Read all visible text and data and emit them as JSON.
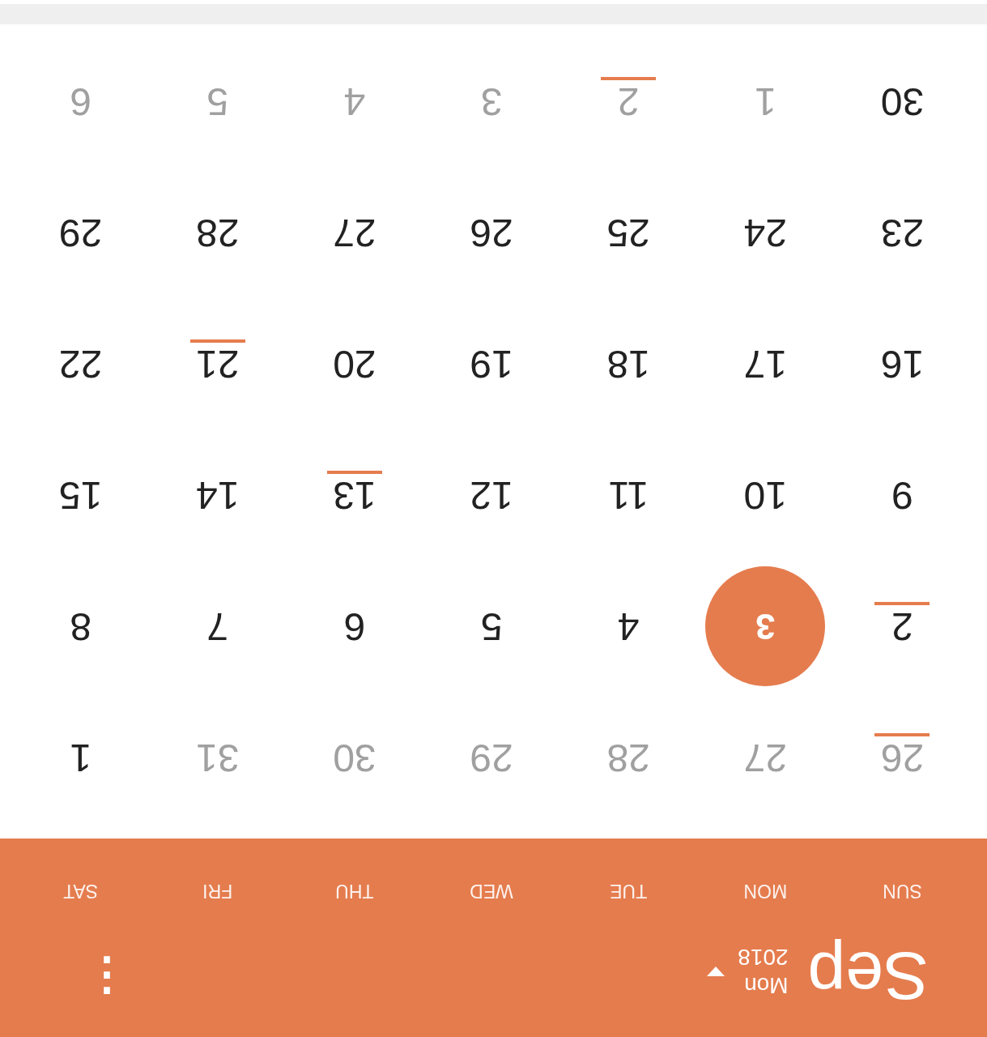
{
  "header": {
    "month": "Sep",
    "weekday": "Mon",
    "year": "2018",
    "menu": "⋮"
  },
  "weekdays": [
    "SUN",
    "MON",
    "TUE",
    "WED",
    "THU",
    "FRI",
    "SAT"
  ],
  "weeks": [
    [
      {
        "day": "26",
        "muted": true,
        "event": true,
        "selected": false
      },
      {
        "day": "27",
        "muted": true,
        "event": false,
        "selected": false
      },
      {
        "day": "28",
        "muted": true,
        "event": false,
        "selected": false
      },
      {
        "day": "29",
        "muted": true,
        "event": false,
        "selected": false
      },
      {
        "day": "30",
        "muted": true,
        "event": false,
        "selected": false
      },
      {
        "day": "31",
        "muted": true,
        "event": false,
        "selected": false
      },
      {
        "day": "1",
        "muted": false,
        "event": false,
        "selected": false
      }
    ],
    [
      {
        "day": "2",
        "muted": false,
        "event": true,
        "selected": false
      },
      {
        "day": "3",
        "muted": false,
        "event": false,
        "selected": true
      },
      {
        "day": "4",
        "muted": false,
        "event": false,
        "selected": false
      },
      {
        "day": "5",
        "muted": false,
        "event": false,
        "selected": false
      },
      {
        "day": "6",
        "muted": false,
        "event": false,
        "selected": false
      },
      {
        "day": "7",
        "muted": false,
        "event": false,
        "selected": false
      },
      {
        "day": "8",
        "muted": false,
        "event": false,
        "selected": false
      }
    ],
    [
      {
        "day": "9",
        "muted": false,
        "event": false,
        "selected": false
      },
      {
        "day": "10",
        "muted": false,
        "event": false,
        "selected": false
      },
      {
        "day": "11",
        "muted": false,
        "event": false,
        "selected": false
      },
      {
        "day": "12",
        "muted": false,
        "event": false,
        "selected": false
      },
      {
        "day": "13",
        "muted": false,
        "event": true,
        "selected": false
      },
      {
        "day": "14",
        "muted": false,
        "event": false,
        "selected": false
      },
      {
        "day": "15",
        "muted": false,
        "event": false,
        "selected": false
      }
    ],
    [
      {
        "day": "16",
        "muted": false,
        "event": false,
        "selected": false
      },
      {
        "day": "17",
        "muted": false,
        "event": false,
        "selected": false
      },
      {
        "day": "18",
        "muted": false,
        "event": false,
        "selected": false
      },
      {
        "day": "19",
        "muted": false,
        "event": false,
        "selected": false
      },
      {
        "day": "20",
        "muted": false,
        "event": false,
        "selected": false
      },
      {
        "day": "21",
        "muted": false,
        "event": true,
        "selected": false
      },
      {
        "day": "22",
        "muted": false,
        "event": false,
        "selected": false
      }
    ],
    [
      {
        "day": "23",
        "muted": false,
        "event": false,
        "selected": false
      },
      {
        "day": "24",
        "muted": false,
        "event": false,
        "selected": false
      },
      {
        "day": "25",
        "muted": false,
        "event": false,
        "selected": false
      },
      {
        "day": "26",
        "muted": false,
        "event": false,
        "selected": false
      },
      {
        "day": "27",
        "muted": false,
        "event": false,
        "selected": false
      },
      {
        "day": "28",
        "muted": false,
        "event": false,
        "selected": false
      },
      {
        "day": "29",
        "muted": false,
        "event": false,
        "selected": false
      }
    ],
    [
      {
        "day": "30",
        "muted": false,
        "event": false,
        "selected": false
      },
      {
        "day": "1",
        "muted": true,
        "event": false,
        "selected": false
      },
      {
        "day": "2",
        "muted": true,
        "event": true,
        "selected": false
      },
      {
        "day": "3",
        "muted": true,
        "event": false,
        "selected": false
      },
      {
        "day": "4",
        "muted": true,
        "event": false,
        "selected": false
      },
      {
        "day": "5",
        "muted": true,
        "event": false,
        "selected": false
      },
      {
        "day": "6",
        "muted": true,
        "event": false,
        "selected": false
      }
    ]
  ]
}
